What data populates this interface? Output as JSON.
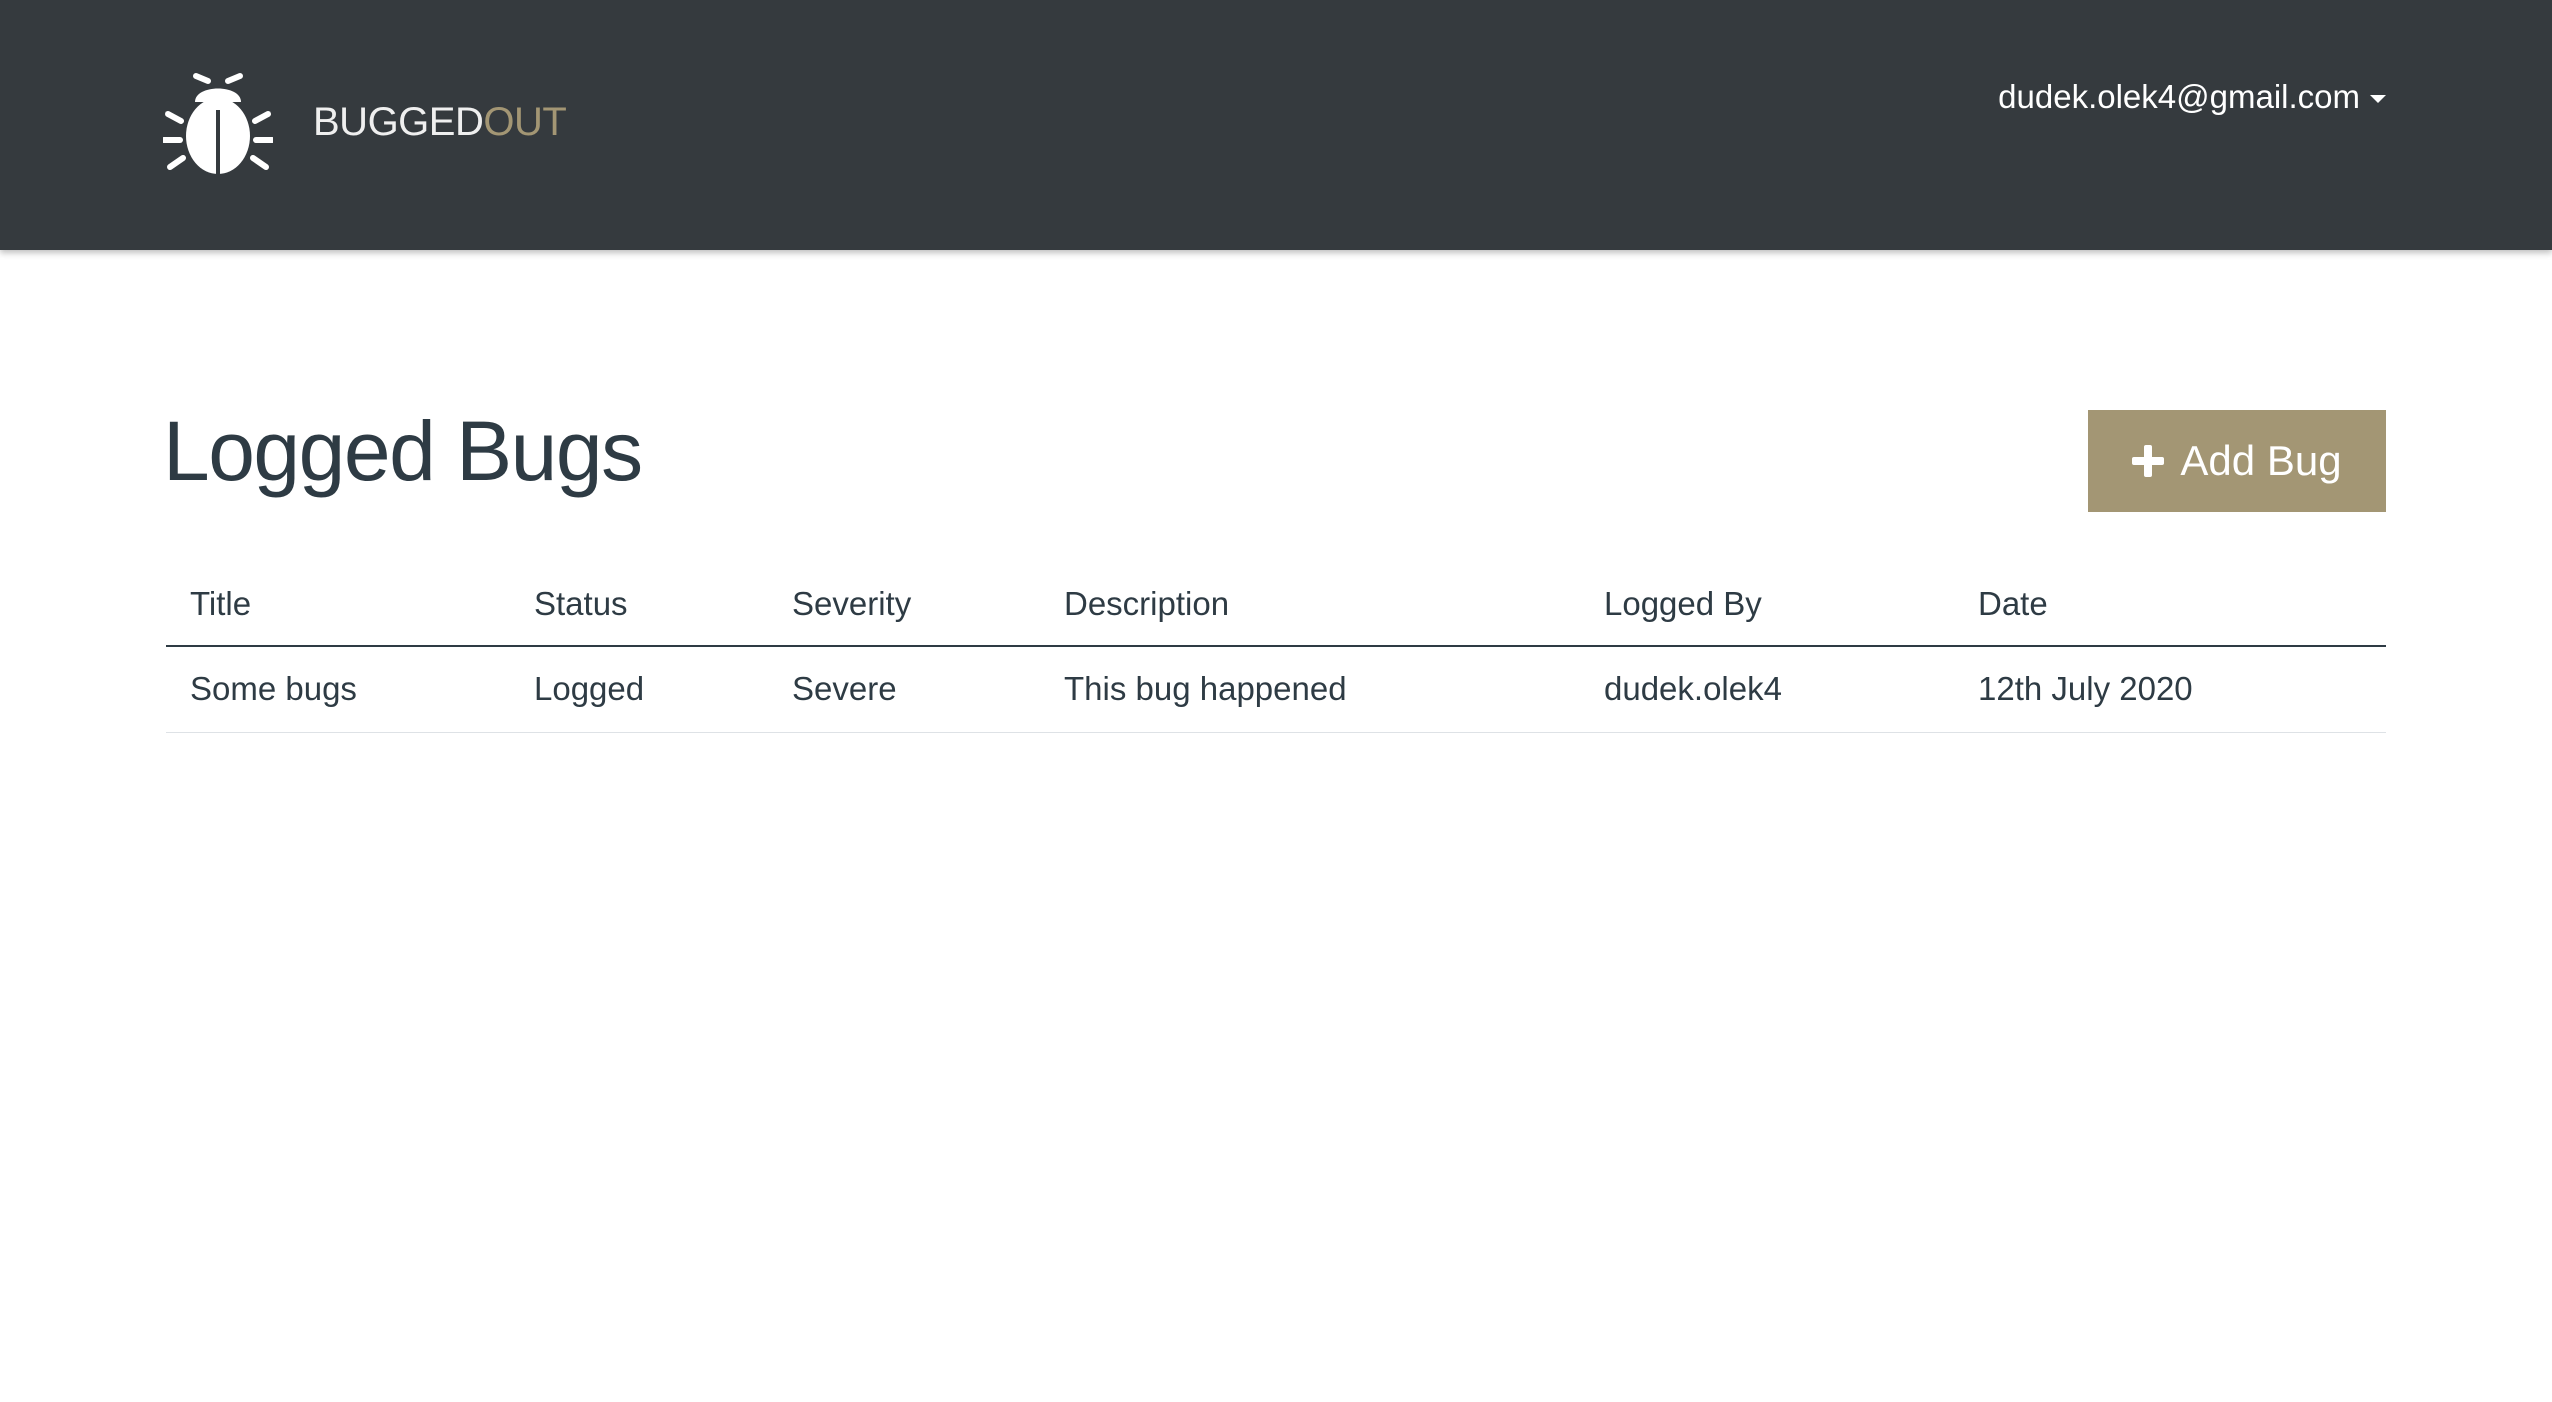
{
  "header": {
    "brand": {
      "part1": "BUGGED",
      "part2": "OUT",
      "logo_icon": "bug-icon"
    },
    "user_email": "dudek.olek4@gmail.com",
    "colors": {
      "bg": "#353a3e",
      "brand_accent": "#a39674"
    }
  },
  "main": {
    "title": "Logged Bugs",
    "add_button": {
      "label": "Add Bug",
      "icon": "plus-icon"
    },
    "table": {
      "columns": [
        "Title",
        "Status",
        "Severity",
        "Description",
        "Logged By",
        "Date"
      ],
      "rows": [
        {
          "title": "Some bugs",
          "status": "Logged",
          "severity": "Severe",
          "description": "This bug happened",
          "logged_by": "dudek.olek4",
          "date": "12th July 2020"
        }
      ]
    }
  }
}
